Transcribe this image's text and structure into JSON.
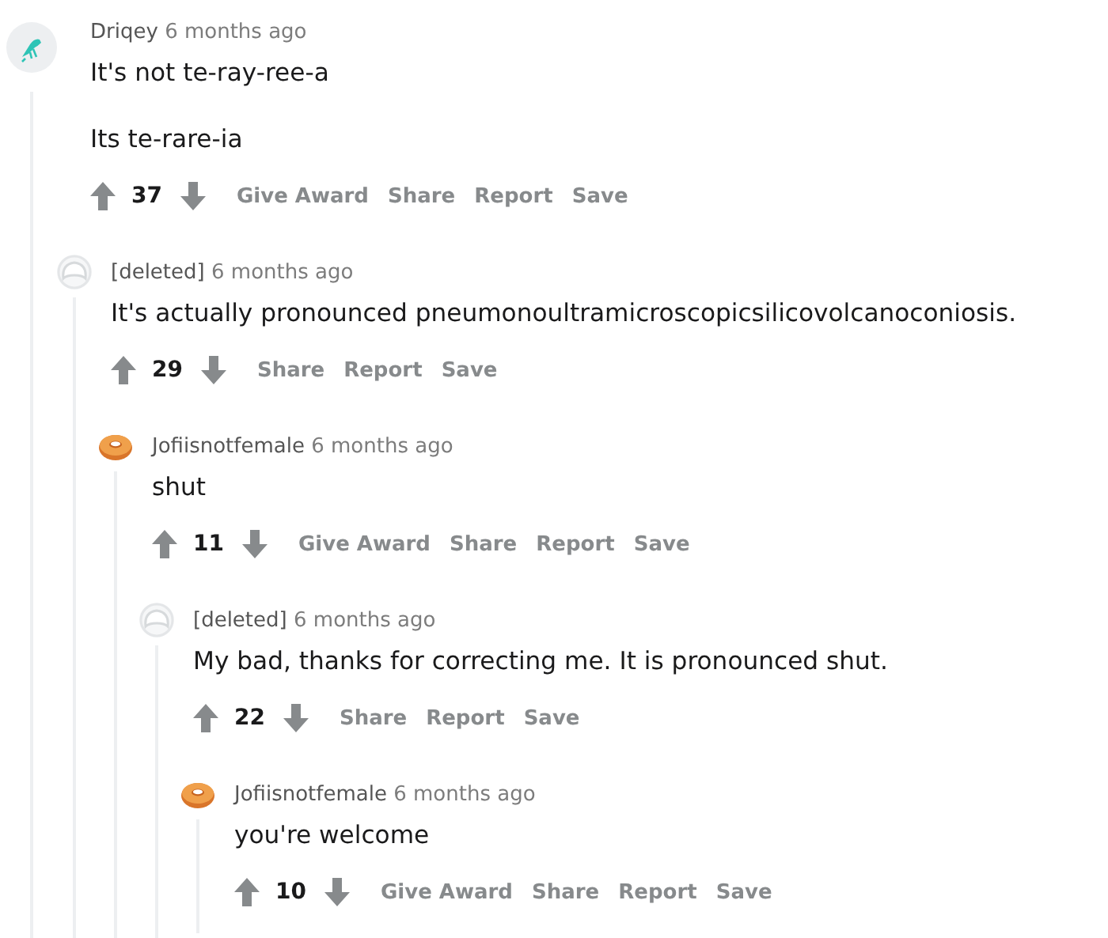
{
  "thread": {
    "avatar": {
      "kind": "insect"
    },
    "author": "Driqey",
    "time": "6 months ago",
    "body": [
      "It's not te-ray-ree-a",
      "Its te-rare-ia"
    ],
    "score": "37",
    "actions": [
      "Give Award",
      "Share",
      "Report",
      "Save"
    ],
    "children": [
      {
        "avatar": {
          "kind": "deleted"
        },
        "author": "[deleted]",
        "time": "6 months ago",
        "body": [
          "It's actually pronounced pneumonoultramicroscopicsilicovolcanoconiosis."
        ],
        "score": "29",
        "actions": [
          "Share",
          "Report",
          "Save"
        ],
        "children": [
          {
            "avatar": {
              "kind": "donut"
            },
            "author": "Jofiisnotfemale",
            "time": "6 months ago",
            "body": [
              "shut"
            ],
            "score": "11",
            "actions": [
              "Give Award",
              "Share",
              "Report",
              "Save"
            ],
            "children": [
              {
                "avatar": {
                  "kind": "deleted"
                },
                "author": "[deleted]",
                "time": "6 months ago",
                "body": [
                  "My bad, thanks for correcting me. It is pronounced shut."
                ],
                "score": "22",
                "actions": [
                  "Share",
                  "Report",
                  "Save"
                ],
                "children": [
                  {
                    "avatar": {
                      "kind": "donut"
                    },
                    "author": "Jofiisnotfemale",
                    "time": "6 months ago",
                    "body": [
                      "you're welcome"
                    ],
                    "score": "10",
                    "actions": [
                      "Give Award",
                      "Share",
                      "Report",
                      "Save"
                    ]
                  }
                ]
              }
            ]
          }
        ]
      }
    ]
  }
}
